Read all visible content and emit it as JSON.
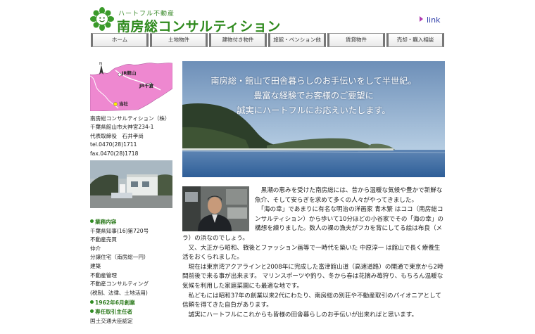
{
  "header": {
    "logo_sub": "ハートフル不動産",
    "logo_main": "南房総コンサルティション",
    "link_label": "link"
  },
  "nav": {
    "items": [
      {
        "label": "ホーム"
      },
      {
        "label": "土地物件"
      },
      {
        "label": "建物付き物件"
      },
      {
        "label": "旅館・ペンション他"
      },
      {
        "label": "賃貸物件"
      },
      {
        "label": "売却・購入相談"
      }
    ]
  },
  "map": {
    "label_station_1": "JR館山",
    "label_station_2": "JR千倉",
    "label_office": "当社",
    "north": "N"
  },
  "company": {
    "name": "南房総コンサルティション（株）",
    "address": "千葉県館山市大神宮234-1",
    "representative": "代表取締役　石井孝尚",
    "tel": "tel.0470(28)1711",
    "fax": "fax.0470(28)1718"
  },
  "info": {
    "business_head": "業務内容",
    "license": "千葉県知事(16)第720号",
    "items": [
      "不動産売買",
      "仲介",
      "分譲住宅（南房総一円）",
      "建築",
      "不動産管理",
      "不動産コンサルティング",
      "(税制、法律、土地活用)"
    ],
    "founded": "1962年6月創業",
    "manager_head": "専任取引主任者",
    "manager_line": "国土交通大臣認定"
  },
  "hero": {
    "line1": "南房総・館山で田舎暮らしのお手伝いをして半世紀。",
    "line2": "豊富な経験でお客様のご要望に",
    "line3": "誠実にハートフルにお応えいたします。"
  },
  "body": {
    "p1": "　黒潮の恵みを受けた南房総には、昔から温暖な気候や豊かで新鮮な魚介、そして安らぎを求めて多くの人々がやってきました。",
    "p2": "　「海の幸」であまりに有名な明治の洋画家 青木繁 はココ（南房総コンサルティション）から歩いて10分ほどの小谷家でその「海の幸」の構想を練りました。数人の裸の漁夫がフカを背にしてる絵は布良（メラ）の浜なのでしょう。",
    "p3": "　又、大正から昭和、戦後とファッション画等で一時代を築いた 中原淳一 は館山で長く療養生活をおくられました。",
    "p4": "　現在は東京湾アクアラインと2008年に完成した富津館山道（高速道路）の開通で東京から2時間前後で来る事が出来ます。 マリンスポーツや釣り、冬から春は花摘み苺狩り、もちろん温暖な気候を利用した家庭菜園にも最適な地です。",
    "p5": "　私どもには昭和37年の創業以来2代にわたり、南房総の別荘や不動産取引のパイオニアとして信頼を得てきた自負があります。",
    "p6": "　誠実にハートフルにこれからも皆様の田舎暮らしのお手伝いが出来ればと思います。"
  }
}
